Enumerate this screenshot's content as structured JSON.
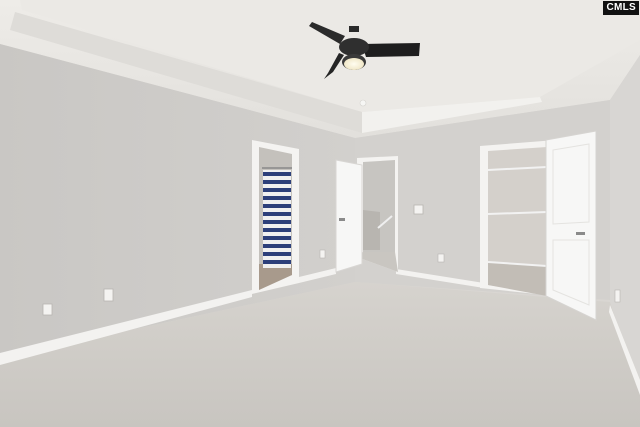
{
  "watermark": {
    "text": "CMLS"
  },
  "colors": {
    "wall": "#cfcdca",
    "ceiling": "#e6e4e0",
    "carpet": "#cfccc7",
    "trim": "#f4f3f1",
    "door": "#f7f7f6",
    "fan": "#2a2a2a",
    "light": "#fffbe8",
    "curtain_blue": "#2c3f7a",
    "curtain_white": "#f0f0f0"
  },
  "icons": {
    "fan": "ceiling-fan-icon",
    "outlet": "outlet-icon",
    "switch": "light-switch-icon"
  }
}
